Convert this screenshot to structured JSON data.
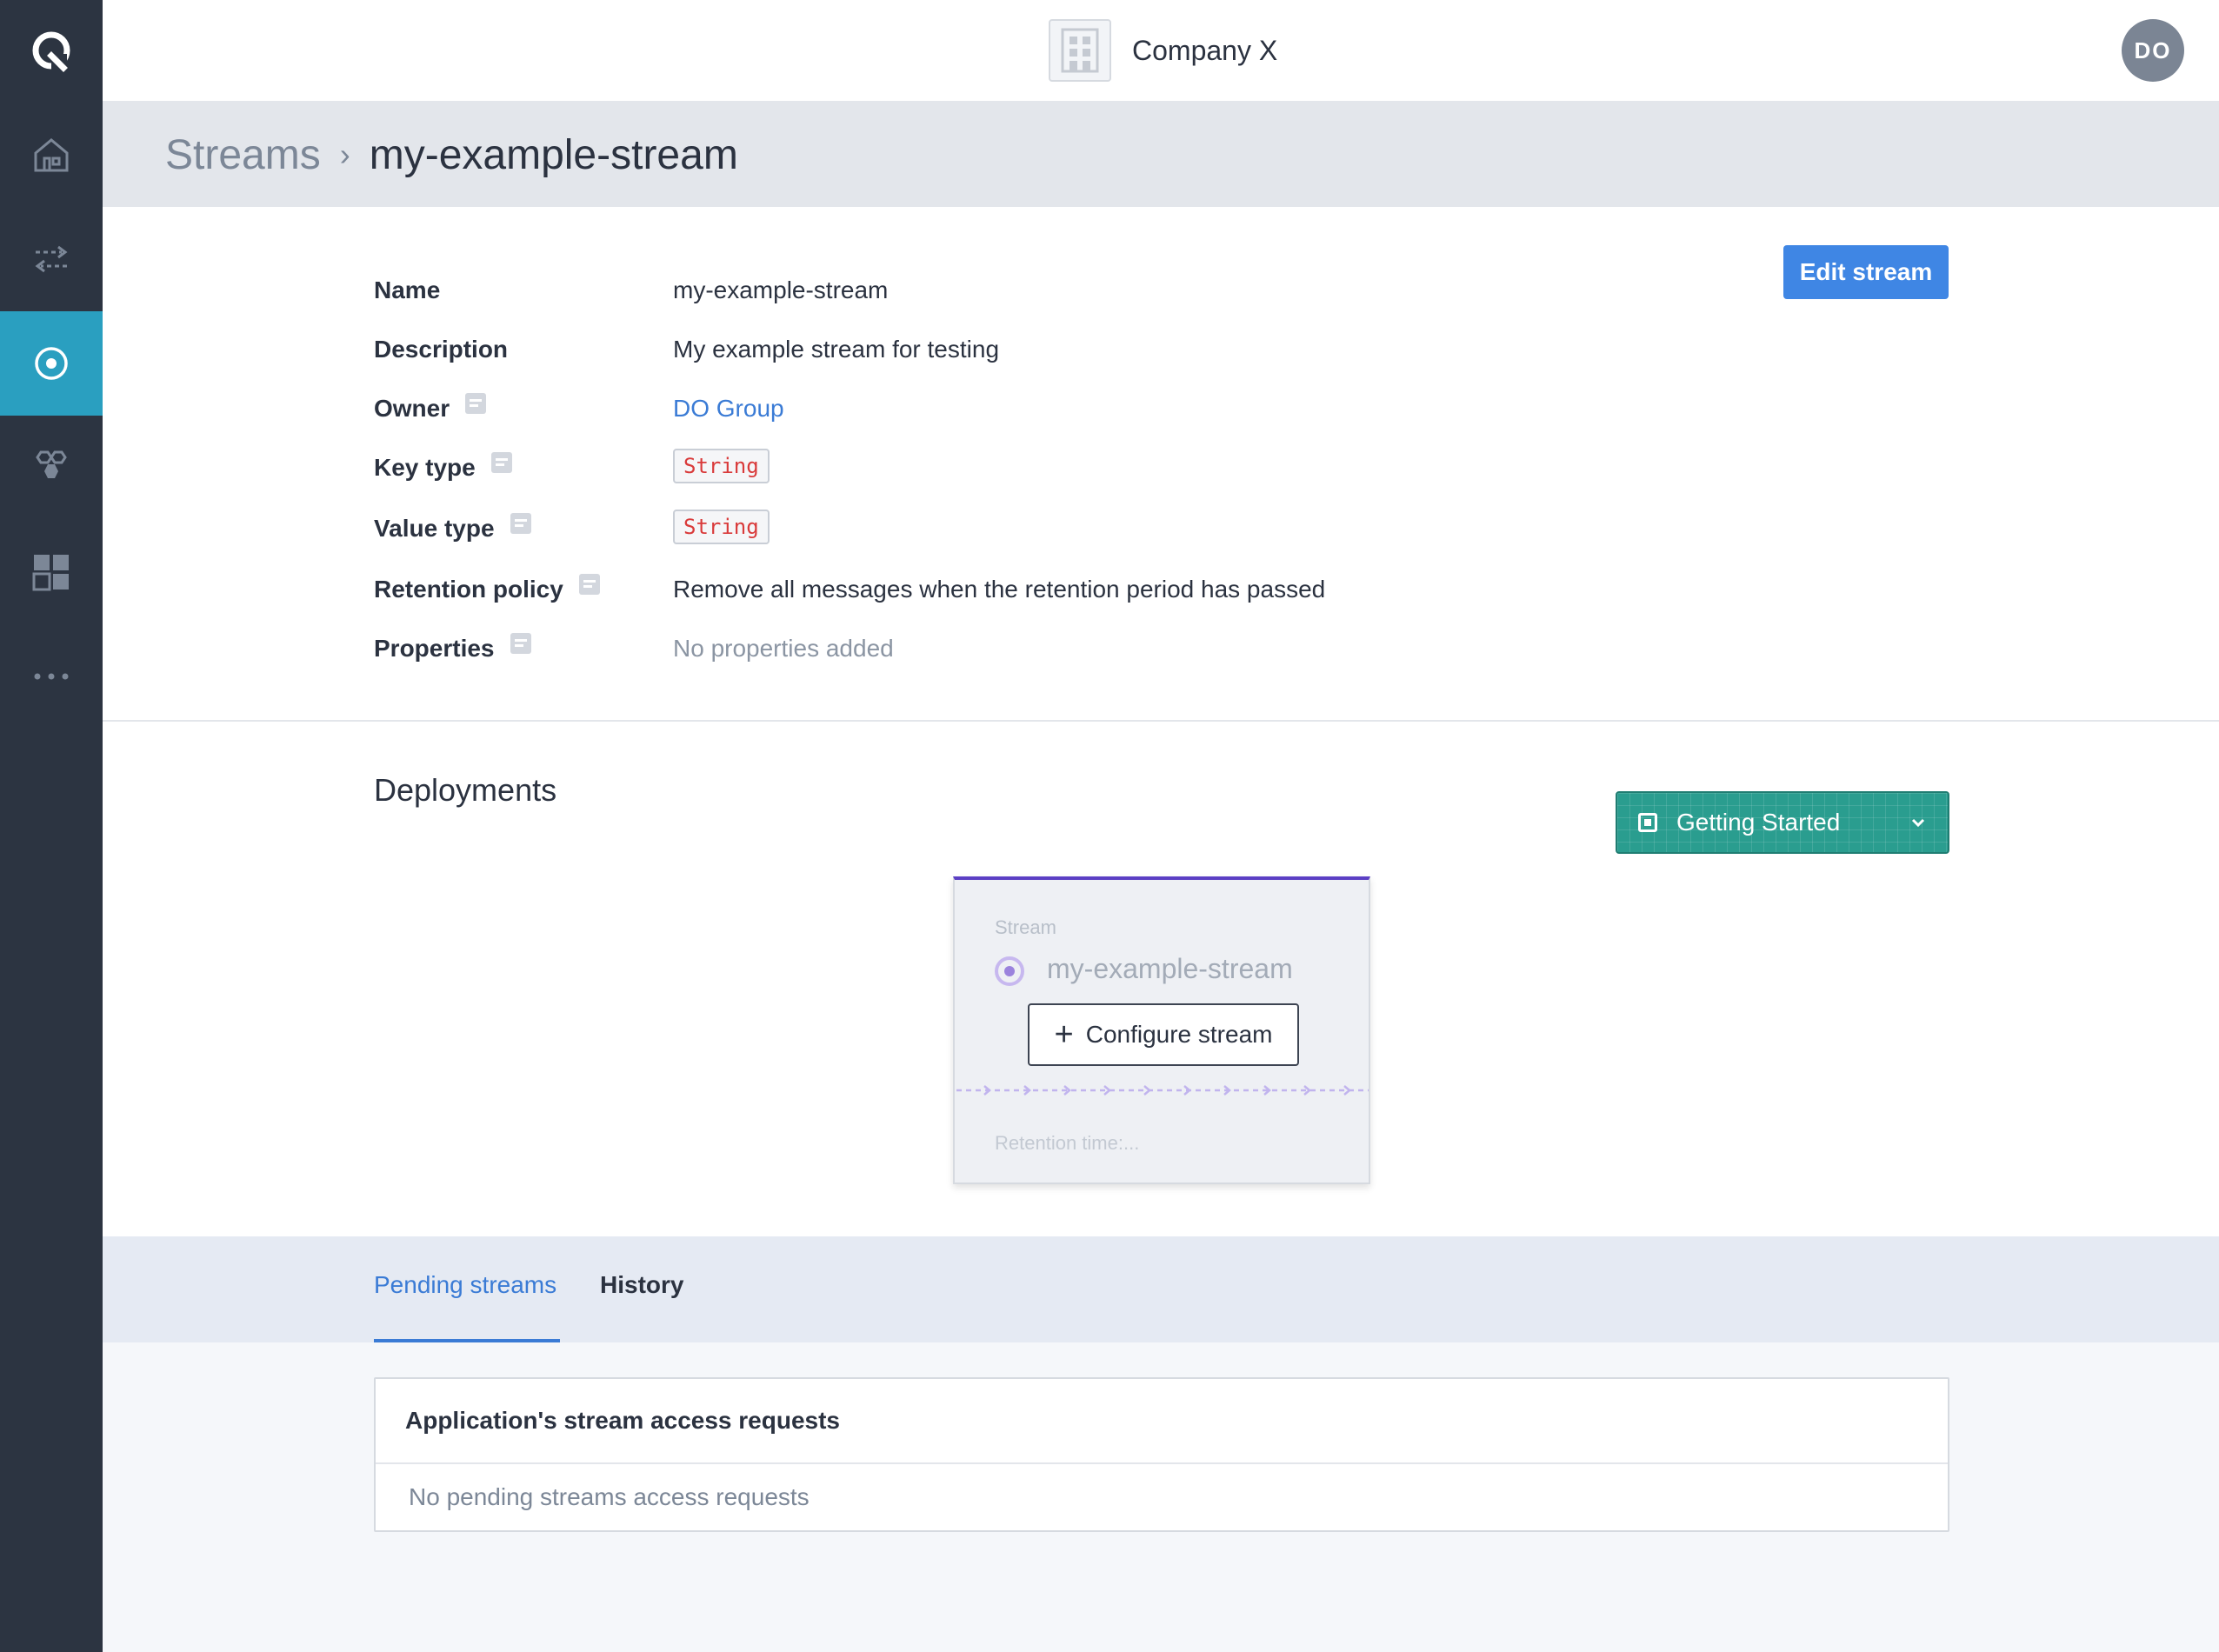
{
  "topbar": {
    "company_name": "Company X",
    "avatar_initials": "DO"
  },
  "sidebar": {
    "items": [
      {
        "icon": "logo-icon"
      },
      {
        "icon": "home-icon"
      },
      {
        "icon": "arrows-exchange-icon"
      },
      {
        "icon": "stream-target-icon",
        "active": true
      },
      {
        "icon": "hexagons-icon"
      },
      {
        "icon": "dashboard-grid-icon"
      },
      {
        "icon": "more-dots-icon"
      }
    ]
  },
  "breadcrumb": {
    "parent": "Streams",
    "separator": "›",
    "current": "my-example-stream"
  },
  "details": {
    "edit_button": "Edit stream",
    "fields": {
      "name": {
        "label": "Name",
        "value": "my-example-stream"
      },
      "description": {
        "label": "Description",
        "value": "My example stream for testing"
      },
      "owner": {
        "label": "Owner",
        "value": "DO Group"
      },
      "key_type": {
        "label": "Key type",
        "value": "String"
      },
      "value_type": {
        "label": "Value type",
        "value": "String"
      },
      "retention_policy": {
        "label": "Retention policy",
        "value": "Remove all messages when the retention period has passed"
      },
      "properties": {
        "label": "Properties",
        "value": "No properties added"
      }
    }
  },
  "deployments": {
    "title": "Deployments",
    "getting_started": "Getting Started",
    "card": {
      "kind": "Stream",
      "name": "my-example-stream",
      "configure_button": "Configure stream",
      "retention": "Retention time:..."
    }
  },
  "tabs": {
    "pending": "Pending streams",
    "history": "History"
  },
  "requests": {
    "title": "Application's stream access requests",
    "empty": "No pending streams access requests"
  },
  "colors": {
    "sidebar_bg": "#2c3441",
    "sidebar_active": "#2a9fc0",
    "primary_blue": "#3f86e4",
    "teal": "#2a9d8f",
    "purple": "#5b3fc4"
  }
}
